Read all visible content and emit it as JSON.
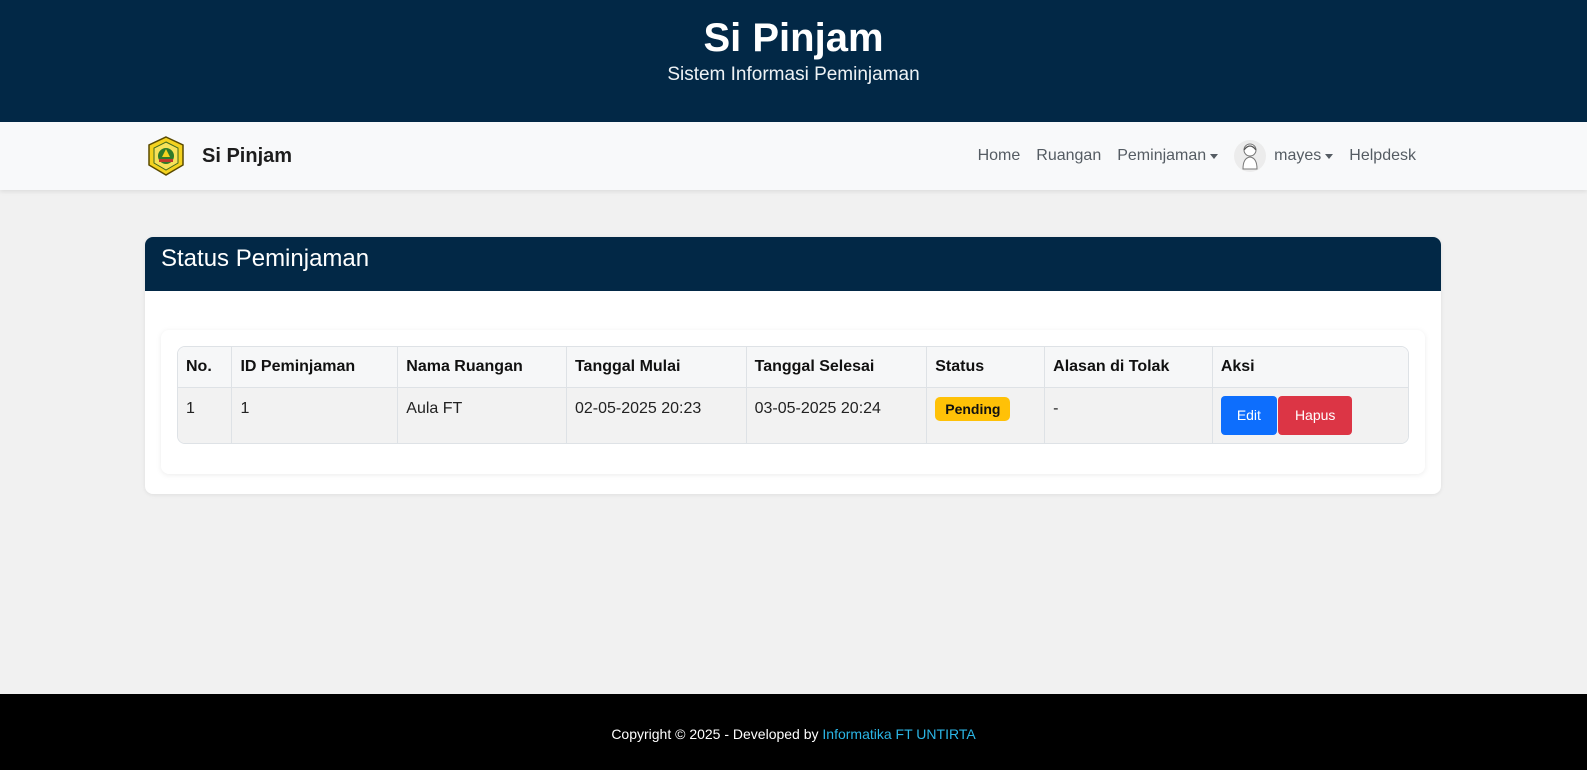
{
  "header": {
    "title": "Si Pinjam",
    "subtitle": "Sistem Informasi Peminjaman"
  },
  "navbar": {
    "brand": "Si Pinjam",
    "links": {
      "home": "Home",
      "ruangan": "Ruangan",
      "peminjaman": "Peminjaman",
      "user": "mayes",
      "helpdesk": "Helpdesk"
    }
  },
  "card": {
    "title": "Status Peminjaman"
  },
  "table": {
    "headers": [
      "No.",
      "ID Peminjaman",
      "Nama Ruangan",
      "Tanggal Mulai",
      "Tanggal Selesai",
      "Status",
      "Alasan di Tolak",
      "Aksi"
    ],
    "rows": [
      {
        "no": "1",
        "id": "1",
        "ruangan": "Aula FT",
        "mulai": "02-05-2025 20:23",
        "selesai": "03-05-2025 20:24",
        "status": "Pending",
        "alasan": "-",
        "edit_label": "Edit",
        "hapus_label": "Hapus"
      }
    ]
  },
  "footer": {
    "text": "Copyright © 2025 - Developed by ",
    "link": "Informatika FT UNTIRTA"
  },
  "colors": {
    "primary_dark": "#022846",
    "status_pending": "#ffc107",
    "edit": "#0d6efd",
    "hapus": "#dc3545",
    "footer_link": "#2bb6e6"
  },
  "icons": {
    "logo": "university-emblem-icon",
    "avatar": "user-avatar-icon"
  }
}
